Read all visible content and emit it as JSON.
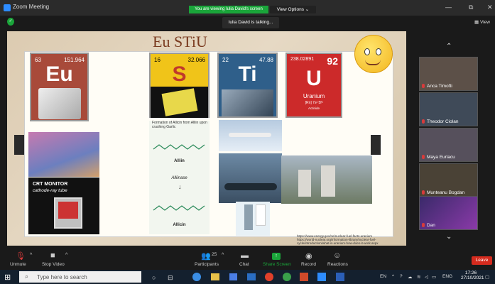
{
  "window": {
    "title": "Zoom Meeting",
    "banner": "You are viewing Iulia David's screen",
    "view_options": "View Options",
    "talking": "Iulia David is talking...",
    "view": "View"
  },
  "slide": {
    "title": "Eu STiU",
    "eu": {
      "number": "63",
      "mass": "151.964",
      "symbol": "Eu"
    },
    "s": {
      "number": "16",
      "mass": "32.066",
      "symbol": "S"
    },
    "ti": {
      "number": "22",
      "mass": "47.88",
      "symbol": "Ti"
    },
    "u": {
      "number": "92",
      "mass": "238.02891",
      "symbol": "U",
      "name": "Uranium",
      "config": "[Rn] 7s² 5f³",
      "series": "Actinide"
    },
    "allicin_caption": "Formation of Allicin from Alliin upon crushing Garlic",
    "alliin": "Alliin",
    "alliinase": "Alliinase",
    "allicin": "Allicin",
    "crt_line1": "CRT MONITOR",
    "crt_line2": "cathode-ray tube",
    "links": [
      "https://www.energy.gov/ne/nuclear-fuel-facts-uranium",
      "https://world-nuclear.org/information-library/nuclear-fuel-",
      "cycle/introduction/what-is-uranium-how-does-it-work.aspx"
    ]
  },
  "participants": [
    {
      "name": "Anca Timofti"
    },
    {
      "name": "Theodor Ciolan"
    },
    {
      "name": "Maya Eurlacu"
    },
    {
      "name": "Munteanu Bogdan"
    },
    {
      "name": "Dan"
    }
  ],
  "toolbar": {
    "unmute": "Unmute",
    "stop_video": "Stop Video",
    "participants": "Participants",
    "participants_count": "25",
    "chat": "Chat",
    "share_screen": "Share Screen",
    "record": "Record",
    "reactions": "Reactions",
    "leave": "Leave"
  },
  "taskbar": {
    "search_placeholder": "Type here to search",
    "lang1": "EN",
    "lang2": "ENG",
    "time": "17:26",
    "date": "27/10/2021"
  },
  "colors": {
    "share_green": "#1aa53a",
    "leave_red": "#d52b1e",
    "eu_card": "#a84a3a",
    "s_card": "#f0c419",
    "ti_card": "#2f5f8a",
    "u_card": "#cc2a2a"
  }
}
